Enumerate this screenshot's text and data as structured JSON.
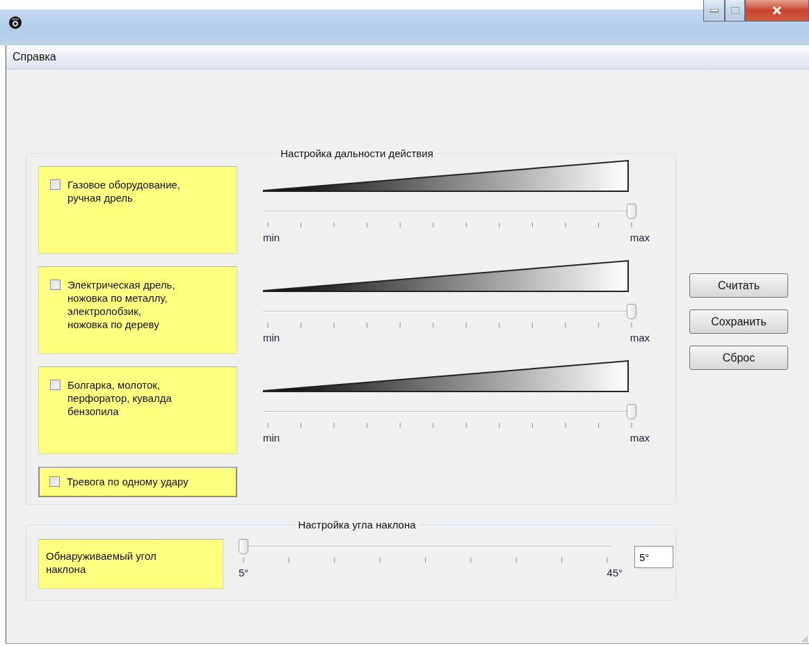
{
  "menu": [
    {
      "label": "Справка"
    }
  ],
  "range_group": {
    "title": "Настройка дальности действия",
    "rows": [
      {
        "label": "Газовое оборудование,\nручная дрель",
        "checked": false,
        "level": 1,
        "min_label": "min",
        "max_label": "max"
      },
      {
        "label": "Электрическая дрель,\nножовка по металлу,\nэлектролобзик,\nножовка по дереву",
        "checked": false,
        "level": 1,
        "min_label": "min",
        "max_label": "max"
      },
      {
        "label": "Болгарка, молоток,\nперфоратор, кувалда\nбензопила",
        "checked": false,
        "level": 1,
        "min_label": "min",
        "max_label": "max"
      }
    ],
    "alarm": {
      "label": "Тревога по одному удару",
      "checked": false
    }
  },
  "angle_group": {
    "title": "Настройка угла наклона",
    "label": "Обнаруживаемый угол\nнаклона",
    "level": 0,
    "min_label": "5°",
    "max_label": "45°",
    "value": "5°"
  },
  "buttons": [
    {
      "label": "Считать"
    },
    {
      "label": "Сохранить"
    },
    {
      "label": "Сброс"
    }
  ]
}
